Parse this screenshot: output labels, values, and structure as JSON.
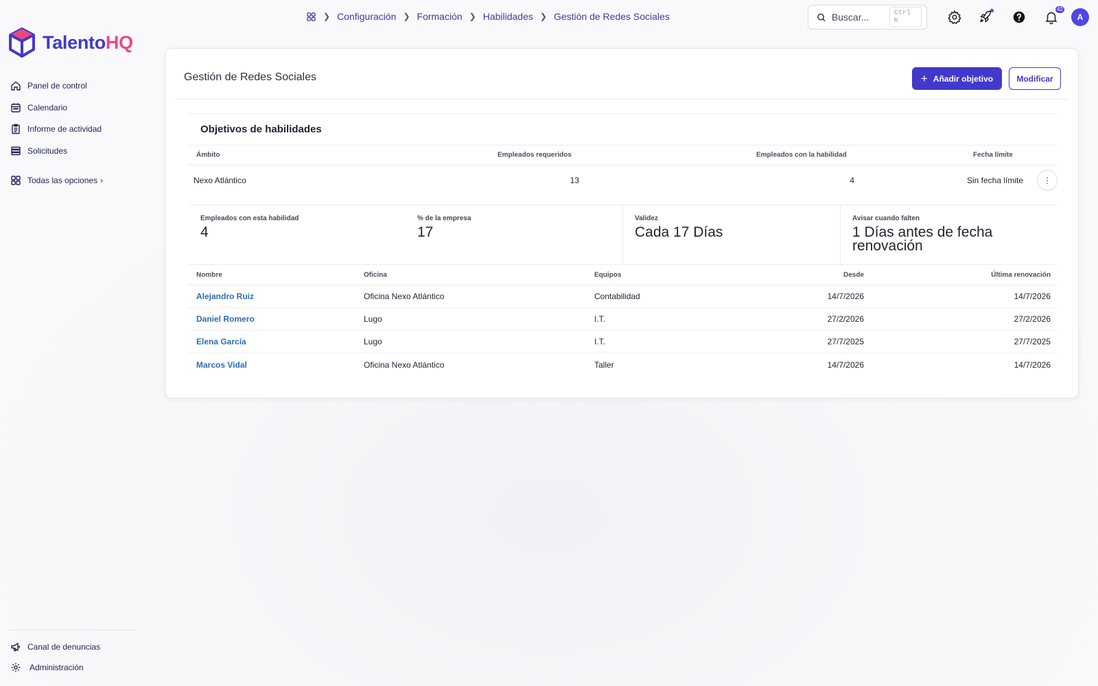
{
  "brand": {
    "name_part1": "Talento",
    "name_part2": "HQ",
    "color_primary": "#4338ca",
    "color_accent": "#e84a7f"
  },
  "sidebar": {
    "items": [
      {
        "label": "Panel de control",
        "icon": "home-icon"
      },
      {
        "label": "Calendario",
        "icon": "calendar-icon"
      },
      {
        "label": "Informe de actividad",
        "icon": "report-icon"
      },
      {
        "label": "Solicitudes",
        "icon": "list-icon"
      }
    ],
    "all_options": {
      "label": "Todas las opciones",
      "icon": "grid-icon"
    },
    "bottom": [
      {
        "label": "Canal de denuncias",
        "icon": "megaphone-icon"
      },
      {
        "label": "Administración",
        "icon": "gear-icon"
      }
    ]
  },
  "breadcrumb": [
    "Configuración",
    "Formación",
    "Habilidades",
    "Gestión de Redes Sociales"
  ],
  "search": {
    "placeholder": "Buscar...",
    "shortcut": "Ctrl K"
  },
  "notifications": {
    "count": "42"
  },
  "avatar": {
    "initial": "A"
  },
  "page": {
    "title": "Gestión de Redes Sociales",
    "add_button": "Añadir objetivo",
    "edit_button": "Modificar"
  },
  "objectives": {
    "title": "Objetivos de habilidades",
    "headers": [
      "Ámbito",
      "Empleados requeridos",
      "Empleados con la habilidad",
      "Fecha límite"
    ],
    "rows": [
      {
        "scope": "Nexo Atlántico",
        "required": "13",
        "with_skill": "4",
        "deadline": "Sin fecha límite"
      }
    ]
  },
  "stats": [
    {
      "label": "Empleados con esta habilidad",
      "value": "4"
    },
    {
      "label": "% de la empresa",
      "value": "17"
    },
    {
      "label": "Validez",
      "value": "Cada 17 Días"
    },
    {
      "label": "Avisar cuando falten",
      "value": "1 Días antes de fecha renovación"
    }
  ],
  "employees": {
    "headers": [
      "Nombre",
      "Oficina",
      "Equipos",
      "Desde",
      "Última renovación"
    ],
    "rows": [
      {
        "name": "Alejandro Ruiz",
        "office": "Oficina Nexo Atlántico",
        "team": "Contabilidad",
        "since": "14/7/2026",
        "renewal": "14/7/2026"
      },
      {
        "name": "Daniel Romero",
        "office": "Lugo",
        "team": "I.T.",
        "since": "27/2/2026",
        "renewal": "27/2/2026"
      },
      {
        "name": "Elena García",
        "office": "Lugo",
        "team": "I.T.",
        "since": "27/7/2025",
        "renewal": "27/7/2025"
      },
      {
        "name": "Marcos Vidal",
        "office": "Oficina Nexo Atlántico",
        "team": "Taller",
        "since": "14/7/2026",
        "renewal": "14/7/2026"
      }
    ]
  }
}
